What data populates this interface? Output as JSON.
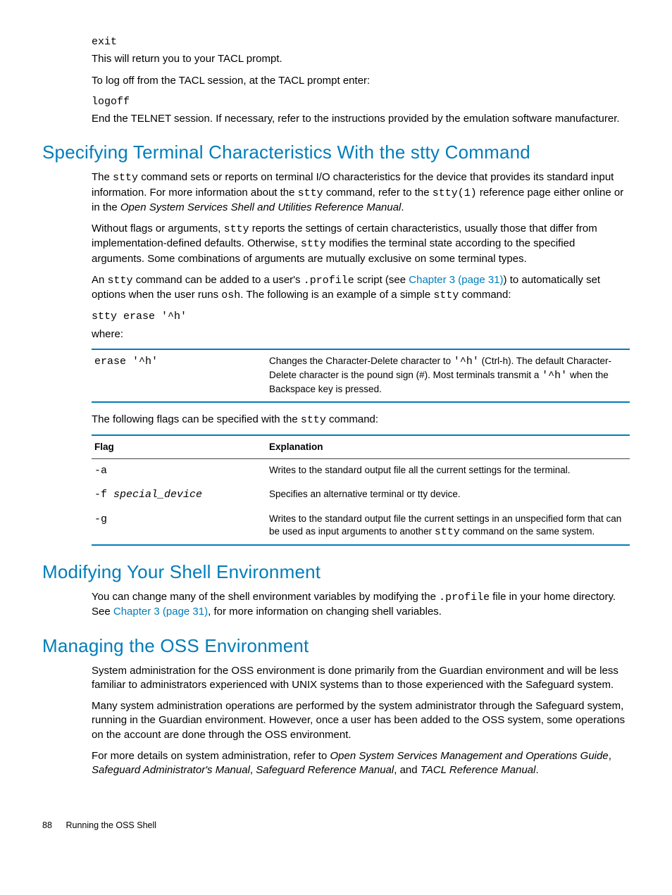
{
  "intro": {
    "code_exit": "exit",
    "p1": "This will return you to your TACL prompt.",
    "p2": "To log off from the TACL session, at the TACL prompt enter:",
    "code_logoff": "logoff",
    "p3": "End the TELNET session. If necessary, refer to the instructions provided by the emulation software manufacturer."
  },
  "sec1": {
    "title": "Specifying Terminal Characteristics With the stty Command",
    "p1a": "The ",
    "p1b": "stty",
    "p1c": " command sets or reports on terminal I/O characteristics for the device that provides its standard input information. For more information about the ",
    "p1d": "stty",
    "p1e": " command, refer to the ",
    "p1f": "stty(1)",
    "p1g": " reference page either online or in the ",
    "p1h": "Open System Services Shell and Utilities Reference Manual",
    "p1i": ".",
    "p2a": "Without flags or arguments, ",
    "p2b": "stty",
    "p2c": " reports the settings of certain characteristics, usually those that differ from implementation-defined defaults. Otherwise, ",
    "p2d": "stty",
    "p2e": " modifies the terminal state according to the specified arguments. Some combinations of arguments are mutually exclusive on some terminal types.",
    "p3a": "An ",
    "p3b": "stty",
    "p3c": " command can be added to a user's ",
    "p3d": ".profile",
    "p3e": " script (see ",
    "p3link": "Chapter 3 (page 31)",
    "p3f": ") to automatically set options when the user runs ",
    "p3g": "osh",
    "p3h": ". The following is an example of a simple ",
    "p3i": "stty",
    "p3j": " command:",
    "code_stty": "stty erase '^h'",
    "where": "where:",
    "tbl1_c1": "erase '^h'",
    "tbl1_c2a": "Changes the Character-Delete character to ",
    "tbl1_c2b": "'^h'",
    "tbl1_c2c": " (Ctrl-h). The default Character-Delete character is the pound sign (#). Most terminals transmit a ",
    "tbl1_c2d": "'^h'",
    "tbl1_c2e": " when the Backspace key is pressed.",
    "p4a": "The following flags can be specified with the ",
    "p4b": "stty",
    "p4c": " command:",
    "tbl2_h1": "Flag",
    "tbl2_h2": "Explanation",
    "tbl2_r1c1": "-a",
    "tbl2_r1c2": "Writes to the standard output file all the current settings for the terminal.",
    "tbl2_r2c1a": "-f ",
    "tbl2_r2c1b": "special_device",
    "tbl2_r2c2": "Specifies an alternative terminal or tty device.",
    "tbl2_r3c1": "-g",
    "tbl2_r3c2a": "Writes to the standard output file the current settings in an unspecified form that can be used as input arguments to another ",
    "tbl2_r3c2b": "stty",
    "tbl2_r3c2c": " command on the same system."
  },
  "sec2": {
    "title": "Modifying Your Shell Environment",
    "p1a": "You can change many of the shell environment variables by modifying the ",
    "p1b": ".profile",
    "p1c": " file in your home directory. See ",
    "p1link": "Chapter 3 (page 31)",
    "p1d": ", for more information on changing shell variables."
  },
  "sec3": {
    "title": "Managing the OSS Environment",
    "p1": "System administration for the OSS environment is done primarily from the Guardian environment and will be less familiar to administrators experienced with UNIX systems than to those experienced with the Safeguard system.",
    "p2": "Many system administration operations are performed by the system administrator through the Safeguard system, running in the Guardian environment. However, once a user has been added to the OSS system, some operations on the account are done through the OSS environment.",
    "p3a": "For more details on system administration, refer to ",
    "p3b": "Open System Services Management and Operations Guide",
    "p3c": ", ",
    "p3d": "Safeguard Administrator's Manual",
    "p3e": ", ",
    "p3f": "Safeguard Reference Manual",
    "p3g": ", and ",
    "p3h": "TACL Reference Manual",
    "p3i": "."
  },
  "footer": {
    "page": "88",
    "chapter": "Running the OSS Shell"
  }
}
